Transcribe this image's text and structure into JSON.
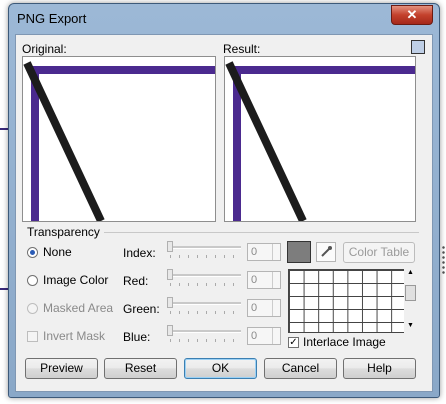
{
  "window": {
    "title": "PNG Export",
    "close_glyph": "✕"
  },
  "preview": {
    "original_label": "Original:",
    "result_label": "Result:",
    "line_color": "#4b2a8f"
  },
  "transparency": {
    "group_label": "Transparency",
    "options": [
      {
        "label": "None",
        "selected": true,
        "enabled": true
      },
      {
        "label": "Image Color",
        "selected": false,
        "enabled": true
      },
      {
        "label": "Masked Area",
        "selected": false,
        "enabled": false
      }
    ],
    "invert_mask_label": "Invert Mask",
    "fields": [
      {
        "label": "Index:",
        "value": "0"
      },
      {
        "label": "Red:",
        "value": "0"
      },
      {
        "label": "Green:",
        "value": "0"
      },
      {
        "label": "Blue:",
        "value": "0"
      }
    ],
    "color_table_label": "Color Table",
    "swatch_color": "#7d7d7d",
    "interlace_label": "Interlace Image",
    "interlace_checked": true
  },
  "buttons": {
    "preview": "Preview",
    "reset": "Reset",
    "ok": "OK",
    "cancel": "Cancel",
    "help": "Help"
  },
  "icons": {
    "save": "save-icon",
    "eyedropper": "eyedropper-icon",
    "scroll_up": "▲",
    "scroll_down": "▼"
  }
}
